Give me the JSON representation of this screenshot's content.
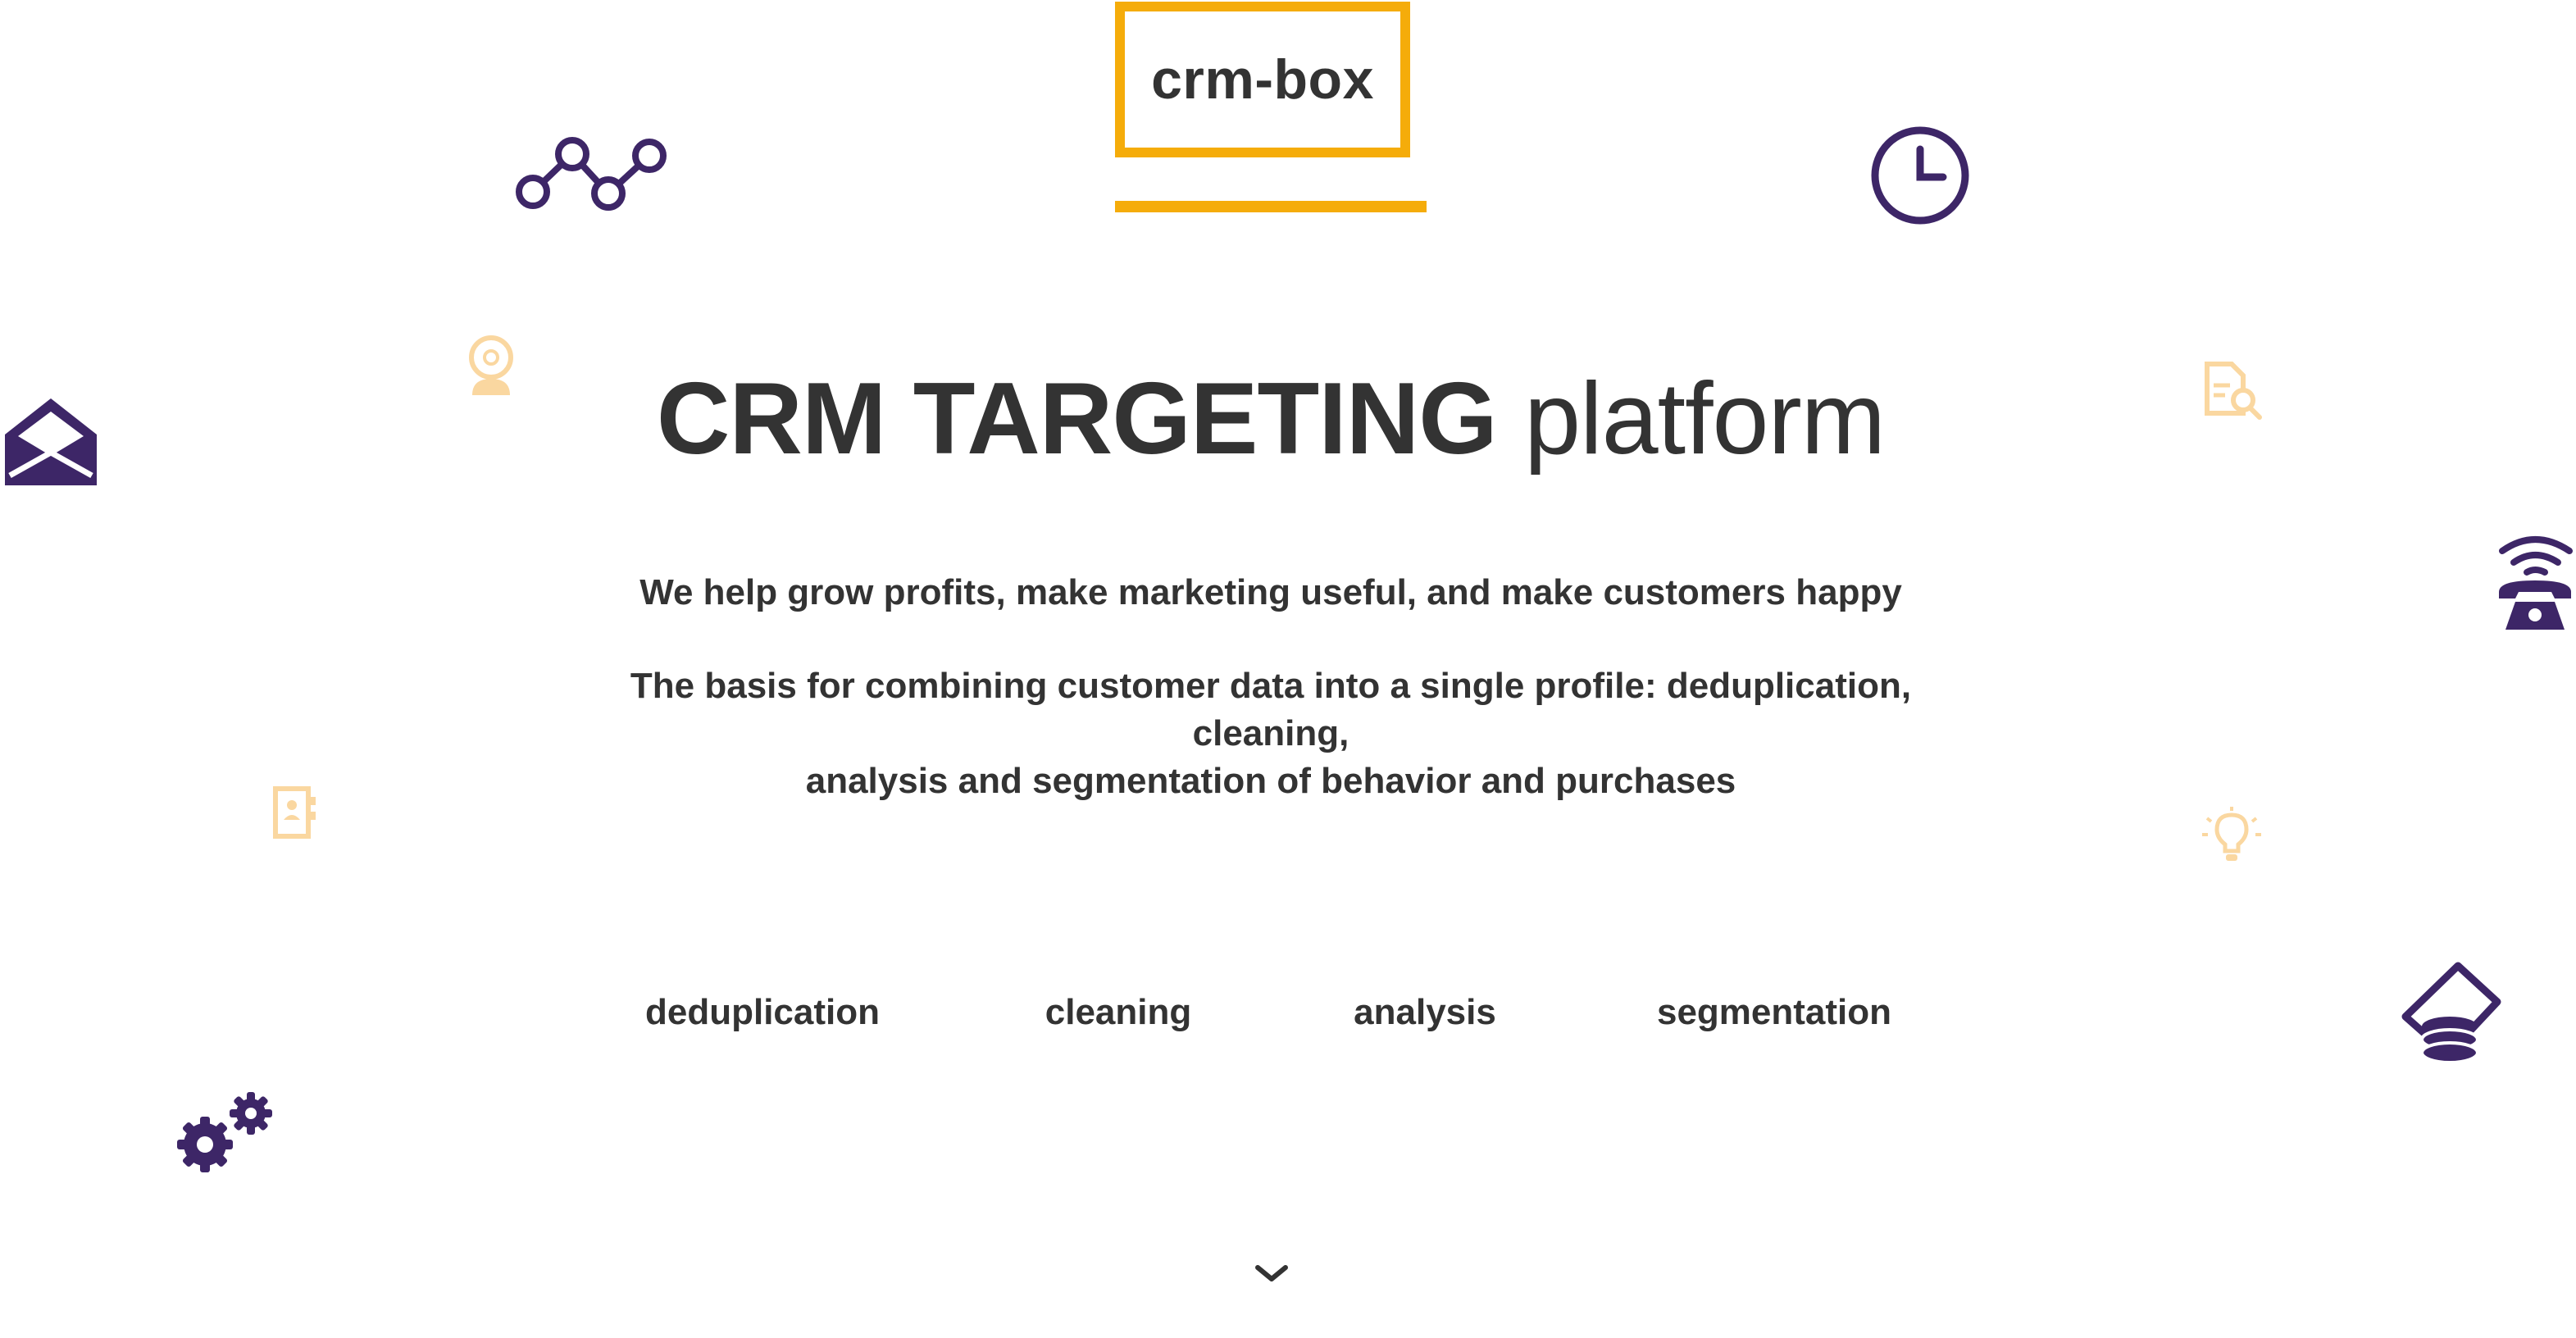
{
  "header": {
    "logo_text": "crm-box"
  },
  "hero": {
    "title_bold": "CRM TARGETING",
    "title_light": "platform",
    "tagline": "We help grow profits, make marketing useful, and make customers happy",
    "description_line1": "The basis for combining customer data into a single profile: deduplication, cleaning,",
    "description_line2": "analysis and segmentation of behavior and purchases"
  },
  "features": [
    {
      "label": "deduplication"
    },
    {
      "label": "cleaning"
    },
    {
      "label": "analysis"
    },
    {
      "label": "segmentation"
    }
  ],
  "icons": {
    "purple": "#3d2667",
    "yellow": "#f5ac0a",
    "light_yellow": "#fad7a0",
    "names": [
      "graph-nodes-icon",
      "clock-icon",
      "webcam-icon",
      "envelope-icon",
      "document-search-icon",
      "telephone-icon",
      "contact-book-icon",
      "lightbulb-icon",
      "money-stack-icon",
      "gears-icon",
      "chevron-down-icon"
    ]
  }
}
